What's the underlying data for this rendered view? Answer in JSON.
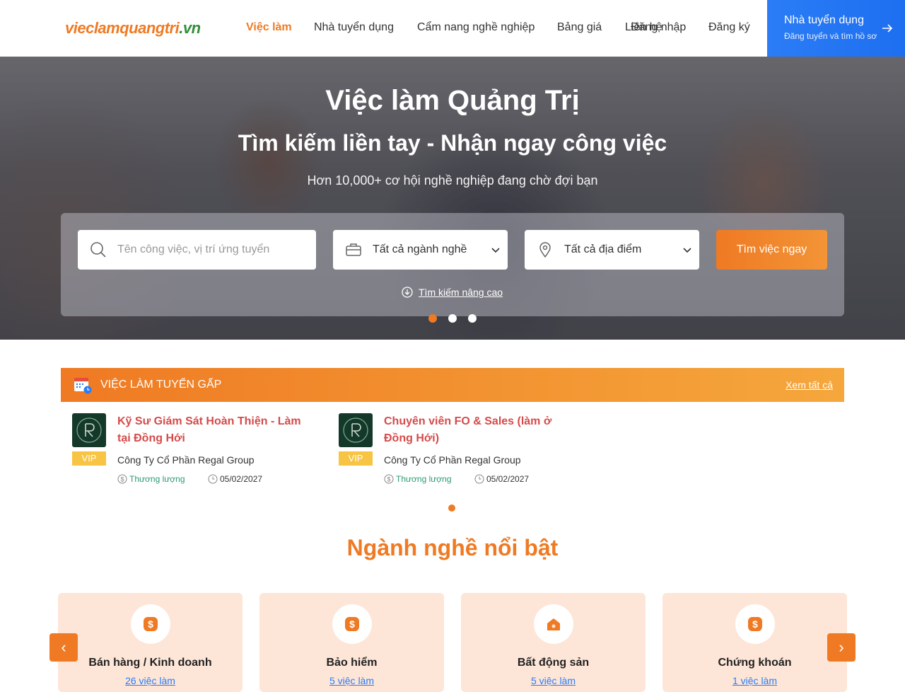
{
  "header": {
    "logo_text_main": "vieclamquangtri",
    "logo_text_tld": ".vn",
    "nav": [
      {
        "label": "Việc làm",
        "active": true
      },
      {
        "label": "Nhà tuyển dụng",
        "active": false
      },
      {
        "label": "Cẩm nang nghề nghiệp",
        "active": false
      },
      {
        "label": "Bảng giá",
        "active": false
      },
      {
        "label": "Liên hệ",
        "active": false
      },
      {
        "label": "Đăng nhập",
        "active": false
      },
      {
        "label": "Đăng ký",
        "active": false
      }
    ],
    "employer_cta": {
      "title": "Nhà tuyển dụng",
      "subtitle": "Đăng tuyển và tìm hồ sơ"
    }
  },
  "hero": {
    "title": "Việc làm Quảng Trị",
    "subtitle": "Tìm kiếm liền tay - Nhận ngay công việc",
    "description": "Hơn 10,000+ cơ hội nghề nghiệp đang chờ đợi bạn",
    "search": {
      "keyword_placeholder": "Tên công việc, vị trí ứng tuyển",
      "industry_value": "Tất cả ngành nghề",
      "location_value": "Tất cả địa điểm",
      "button": "Tìm việc ngay",
      "advanced": "Tìm kiếm nâng cao"
    },
    "slides": 3,
    "active_slide": 1
  },
  "urgent": {
    "title": "VIỆC LÀM TUYỂN GẤP",
    "see_all": "Xem tất cả",
    "jobs": [
      {
        "title": "Kỹ Sư Giám Sát Hoàn Thiện - Làm tại Đồng Hới",
        "company": "Công Ty Cổ Phần Regal Group",
        "badge": "VIP",
        "salary": "Thương lượng",
        "deadline": "05/02/2027"
      },
      {
        "title": "Chuyên viên FO & Sales (làm ở Đồng Hới)",
        "company": "Công Ty Cổ Phần Regal Group",
        "badge": "VIP",
        "salary": "Thương lượng",
        "deadline": "05/02/2027"
      }
    ]
  },
  "sectors": {
    "title": "Ngành nghề nổi bật",
    "items": [
      {
        "name": "Bán hàng / Kinh doanh",
        "count": "26 việc làm",
        "icon": "dollar-icon"
      },
      {
        "name": "Bảo hiểm",
        "count": "5 việc làm",
        "icon": "dollar-icon"
      },
      {
        "name": "Bất động sản",
        "count": "5 việc làm",
        "icon": "house-icon"
      },
      {
        "name": "Chứng khoán",
        "count": "1 việc làm",
        "icon": "dollar-icon"
      }
    ],
    "prev": "‹",
    "next": "›"
  },
  "colors": {
    "accent": "#ef7a23",
    "blue": "#2b7cf6",
    "job_title": "#d64a4a",
    "salary": "#2a9b6f",
    "vip": "#f7c443",
    "card": "#fde6d8"
  }
}
